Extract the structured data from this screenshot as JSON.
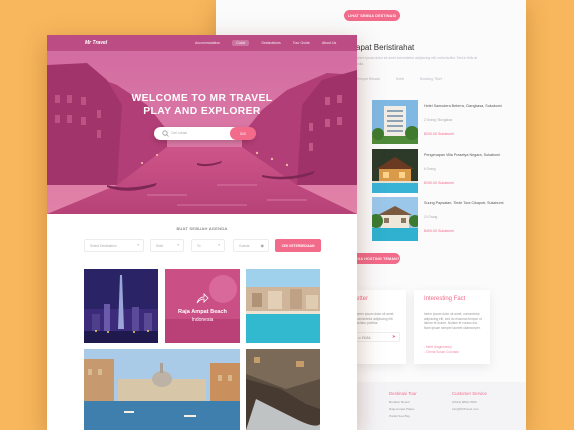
{
  "back_page": {
    "top_button": "LIHAT SEMUA DESTINASI",
    "section_title": "apat Beristirahat",
    "section_desc": "lorem ipsum dolor sit amet consectetur adipiscing elit, nulla facilisi. Sed in felis at nulla.",
    "tabs": [
      "Tempat Wisata",
      "Hotel",
      "Booking Tiket"
    ],
    "hotels": [
      {
        "name": "Hotel Samudera Beterra, Ciangkasa, Sukabumi",
        "sub": "2 Orang / Bungalow",
        "price": "$200.00 Sukabumi"
      },
      {
        "name": "Pengenapan Villa Prasetya Negara, Sukabumi",
        "sub": "6 Orang",
        "price": "$150.00 Sukabumi"
      },
      {
        "name": "Suung Papsatan, Tiede Tora Cikaputr, Sukabumi",
        "sub": "10 Orang",
        "price": "$400.00 Sukabumi"
      }
    ],
    "middle_button": "LIHAT SEMUA HOSTING TEMAN?",
    "card_left": {
      "title": "etter",
      "text": "lorem ipsum dolor sit amet, consectetur adipiscing elit. Nullam porttitor.",
      "email": "ur EMAIL"
    },
    "card_right": {
      "title": "Interesting Fact",
      "text": "lorem ipsum dolor sit amet, consectetur adipiscing elit, sed do eiusmod tempor ut labore et dolore. Nullam et cursus est. Nam ipsum semper laoreet ullamcorper.",
      "link1": "- Meet Ulagrimanny",
      "link2": "- Cherai Susan Colorado"
    },
    "footer": {
      "col1_title": "Destinasi Tour",
      "col1_items": [
        "Beraliim Beach",
        "Raja Ampat Pialpe",
        "Paniki Sea Bay"
      ],
      "col2_title": "Customer Service",
      "col2_items": [
        "(0344) 8890-7890",
        "info@MrTravel.com"
      ]
    }
  },
  "front_page": {
    "logo": "Mr Travel",
    "nav": [
      "Accommodation",
      "Guide",
      "Destinations",
      "Tour Guide",
      "About Us"
    ],
    "active_nav_index": 1,
    "hero": {
      "line1": "WELCOME TO MR TRAVEL",
      "line2": "PLAY AND EXPLORER",
      "search_placeholder": "Cari Lokasi",
      "search_button": "GO!"
    },
    "agenda": {
      "title": "BUAT SEBUAH AGENDA",
      "fields": [
        "Select Destination",
        "Start",
        "To",
        "Guests"
      ],
      "button": "CEK KETERSEDIAAN"
    },
    "featured": {
      "title": "Raja Ampat Beach",
      "subtitle": "Indonesia"
    }
  },
  "colors": {
    "background": "#f8b75c",
    "accent": "#f26b8a",
    "hero_tint": "#d8467f"
  }
}
